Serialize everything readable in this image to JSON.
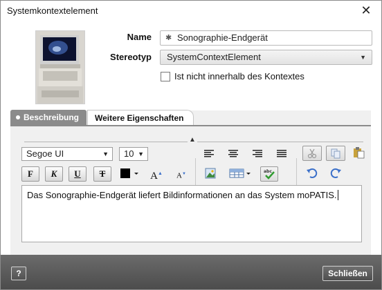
{
  "window": {
    "title": "Systemkontextelement",
    "close_icon": "close-icon"
  },
  "form": {
    "name_label": "Name",
    "name_value": "Sonographie-Endgerät",
    "required_marker": "✱",
    "stereotype_label": "Stereotyp",
    "stereotype_value": "SystemContextElement",
    "outside_checkbox_label": "Ist nicht innerhalb des Kontextes",
    "outside_checked": false
  },
  "tabs": [
    {
      "label": "Beschreibung",
      "active": true
    },
    {
      "label": "Weitere Eigenschaften",
      "active": false
    }
  ],
  "toolbar": {
    "font_family": "Segoe UI",
    "font_size": "10",
    "bold_label": "F",
    "italic_label": "K",
    "underline_label": "U",
    "strike_label": "T",
    "grow_label": "A",
    "shrink_label": "A",
    "font_color": "#000000"
  },
  "editor": {
    "text": "Das Sonographie-Endgerät liefert Bildinformationen an das System moPATIS."
  },
  "footer": {
    "help_label": "?",
    "close_label": "Schließen"
  },
  "colors": {
    "tab_active": "#8b8b8b",
    "footer": "#5a5a5a",
    "paste_icon": "#c8a23c",
    "undo_icon": "#3a6fc9"
  }
}
